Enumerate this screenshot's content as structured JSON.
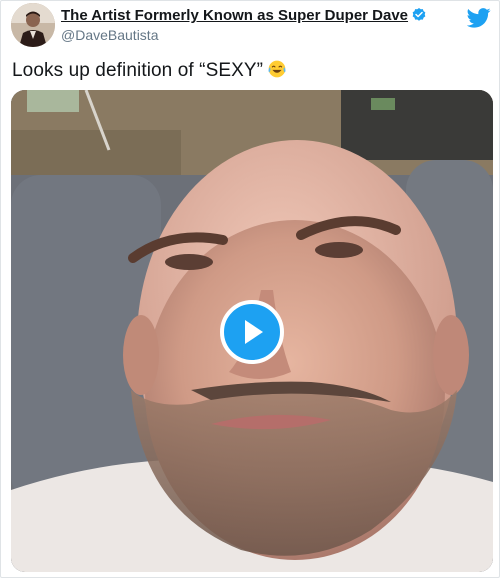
{
  "tweet": {
    "display_name": "The Artist Formerly Known as Super Duper Dave",
    "handle": "@DaveBautista",
    "text": "Looks up definition of “SEXY”",
    "emoji": "tears-of-joy-emoji"
  },
  "icons": {
    "verified": "verified-badge-icon",
    "brand": "twitter-bird-icon",
    "play": "play-icon"
  },
  "colors": {
    "brand_blue": "#1da1f2",
    "name_text": "#14171a",
    "handle_text": "#657786"
  }
}
